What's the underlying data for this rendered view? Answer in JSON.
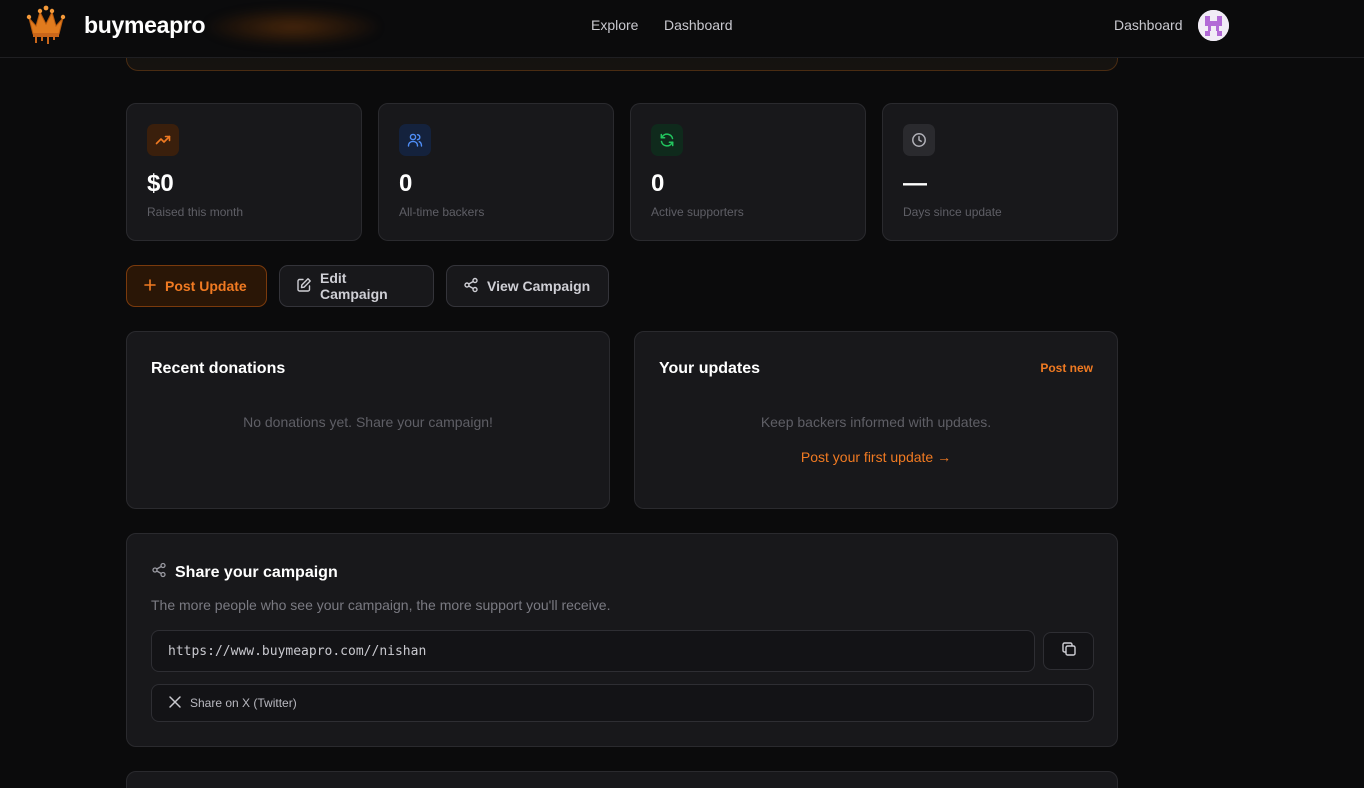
{
  "header": {
    "brand": "buymeapro",
    "nav": {
      "explore": "Explore",
      "dashboard": "Dashboard"
    },
    "right_dashboard": "Dashboard"
  },
  "stats": [
    {
      "icon": "trending-up-icon",
      "value": "$0",
      "label": "Raised this month",
      "accent": "#f07a22"
    },
    {
      "icon": "users-icon",
      "value": "0",
      "label": "All-time backers",
      "accent": "#4f8ef7"
    },
    {
      "icon": "refresh-icon",
      "value": "0",
      "label": "Active supporters",
      "accent": "#22c55e"
    },
    {
      "icon": "clock-icon",
      "value": "—",
      "label": "Days since update",
      "accent": "#9a9aa2"
    }
  ],
  "actions": {
    "post_update": "Post Update",
    "edit_campaign": "Edit Campaign",
    "view_campaign": "View Campaign"
  },
  "donations": {
    "title": "Recent donations",
    "empty": "No donations yet. Share your campaign!"
  },
  "updates": {
    "title": "Your updates",
    "post_new": "Post new",
    "empty": "Keep backers informed with updates.",
    "first_update": "Post your first update →"
  },
  "share": {
    "title": "Share your campaign",
    "description": "The more people who see your campaign, the more support you'll receive.",
    "url": "https://www.buymeapro.com//nishan",
    "twitter": "Share on X (Twitter)"
  },
  "colors": {
    "accent": "#f07a22",
    "background": "#0b0b0c",
    "card": "#18181b"
  }
}
